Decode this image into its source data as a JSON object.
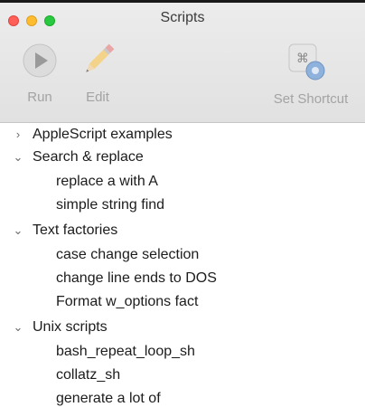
{
  "window": {
    "title": "Scripts"
  },
  "toolbar": {
    "run_label": "Run",
    "edit_label": "Edit",
    "shortcut_label": "Set Shortcut"
  },
  "list": {
    "groups": [
      {
        "name": "AppleScript examples",
        "expanded": false,
        "items": []
      },
      {
        "name": "Search & replace",
        "expanded": true,
        "items": [
          "replace a with A",
          "simple string find"
        ]
      },
      {
        "name": "Text factories",
        "expanded": true,
        "items": [
          "case change selection",
          "change line ends to DOS",
          "Format w_options fact"
        ]
      },
      {
        "name": "Unix scripts",
        "expanded": true,
        "items": [
          "bash_repeat_loop_sh",
          "collatz_sh",
          "generate a lot of"
        ]
      }
    ],
    "collapsed_glyph": "›",
    "expanded_glyph": "⌄"
  },
  "icons": {
    "run": "play-icon",
    "edit": "pencil-icon",
    "shortcut": "command-gear-icon"
  },
  "colors": {
    "close": "#ff5f57",
    "minimize": "#febc2e",
    "zoom": "#28c840",
    "disabled_label": "#a3a3a3"
  }
}
